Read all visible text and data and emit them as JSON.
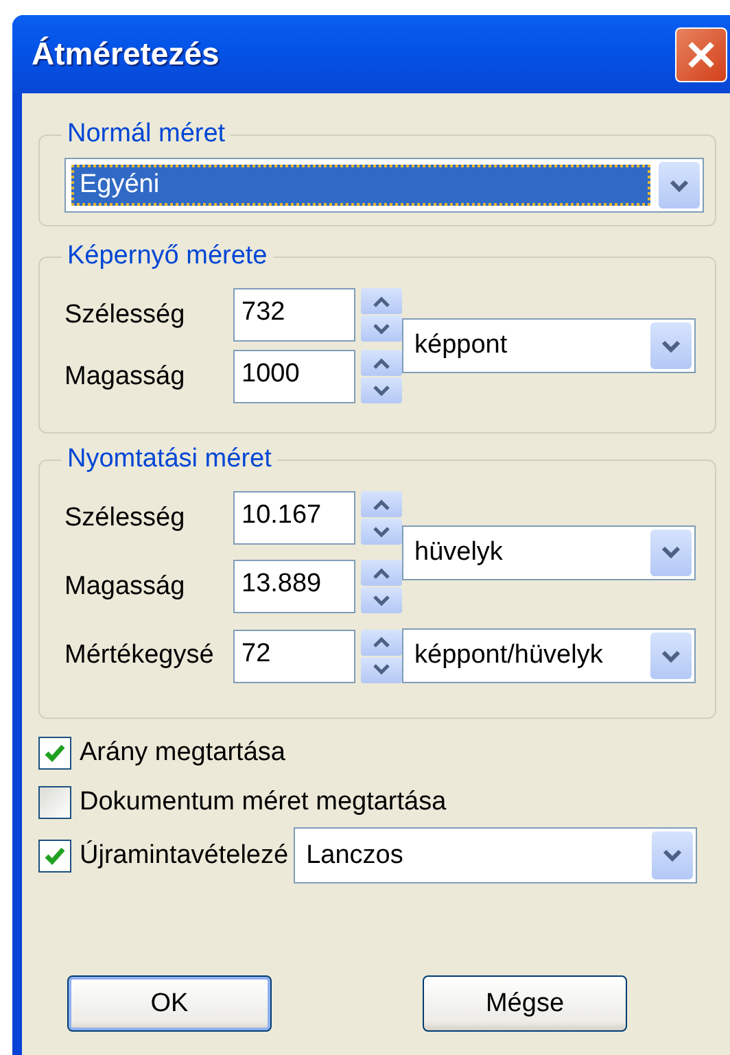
{
  "window": {
    "title": "Átméretezés"
  },
  "normal_size": {
    "legend": "Normál méret",
    "dropdown": {
      "value": "Egyéni",
      "focused": true
    }
  },
  "screen_size": {
    "legend": "Képernyő mérete",
    "fields": [
      {
        "label": "Szélesség",
        "value": "732"
      },
      {
        "label": "Magasság",
        "value": "1000"
      }
    ],
    "units": [
      {
        "value": "képpont",
        "kind": "paired"
      }
    ]
  },
  "print_size": {
    "legend": "Nyomtatási méret",
    "fields": [
      {
        "label": "Szélesség",
        "value": "10.167"
      },
      {
        "label": "Magasság",
        "value": "13.889"
      },
      {
        "label": "Mértékegysé",
        "value": "72"
      }
    ],
    "units": [
      {
        "value": "hüvelyk",
        "kind": "paired"
      },
      {
        "value": "képpont/hüvelyk",
        "kind": "single"
      }
    ]
  },
  "options": [
    {
      "label": "Arány megtartása",
      "checked": true,
      "kind": "plain"
    },
    {
      "label": "Dokumentum méret megtartása",
      "checked": false,
      "kind": "plain"
    },
    {
      "label": "Újramintavételezé",
      "checked": true,
      "kind": "with_dropdown",
      "dropdown": "Lanczos"
    }
  ],
  "buttons": [
    {
      "label": "OK",
      "default": true
    },
    {
      "label": "Mégse",
      "default": false
    }
  ]
}
